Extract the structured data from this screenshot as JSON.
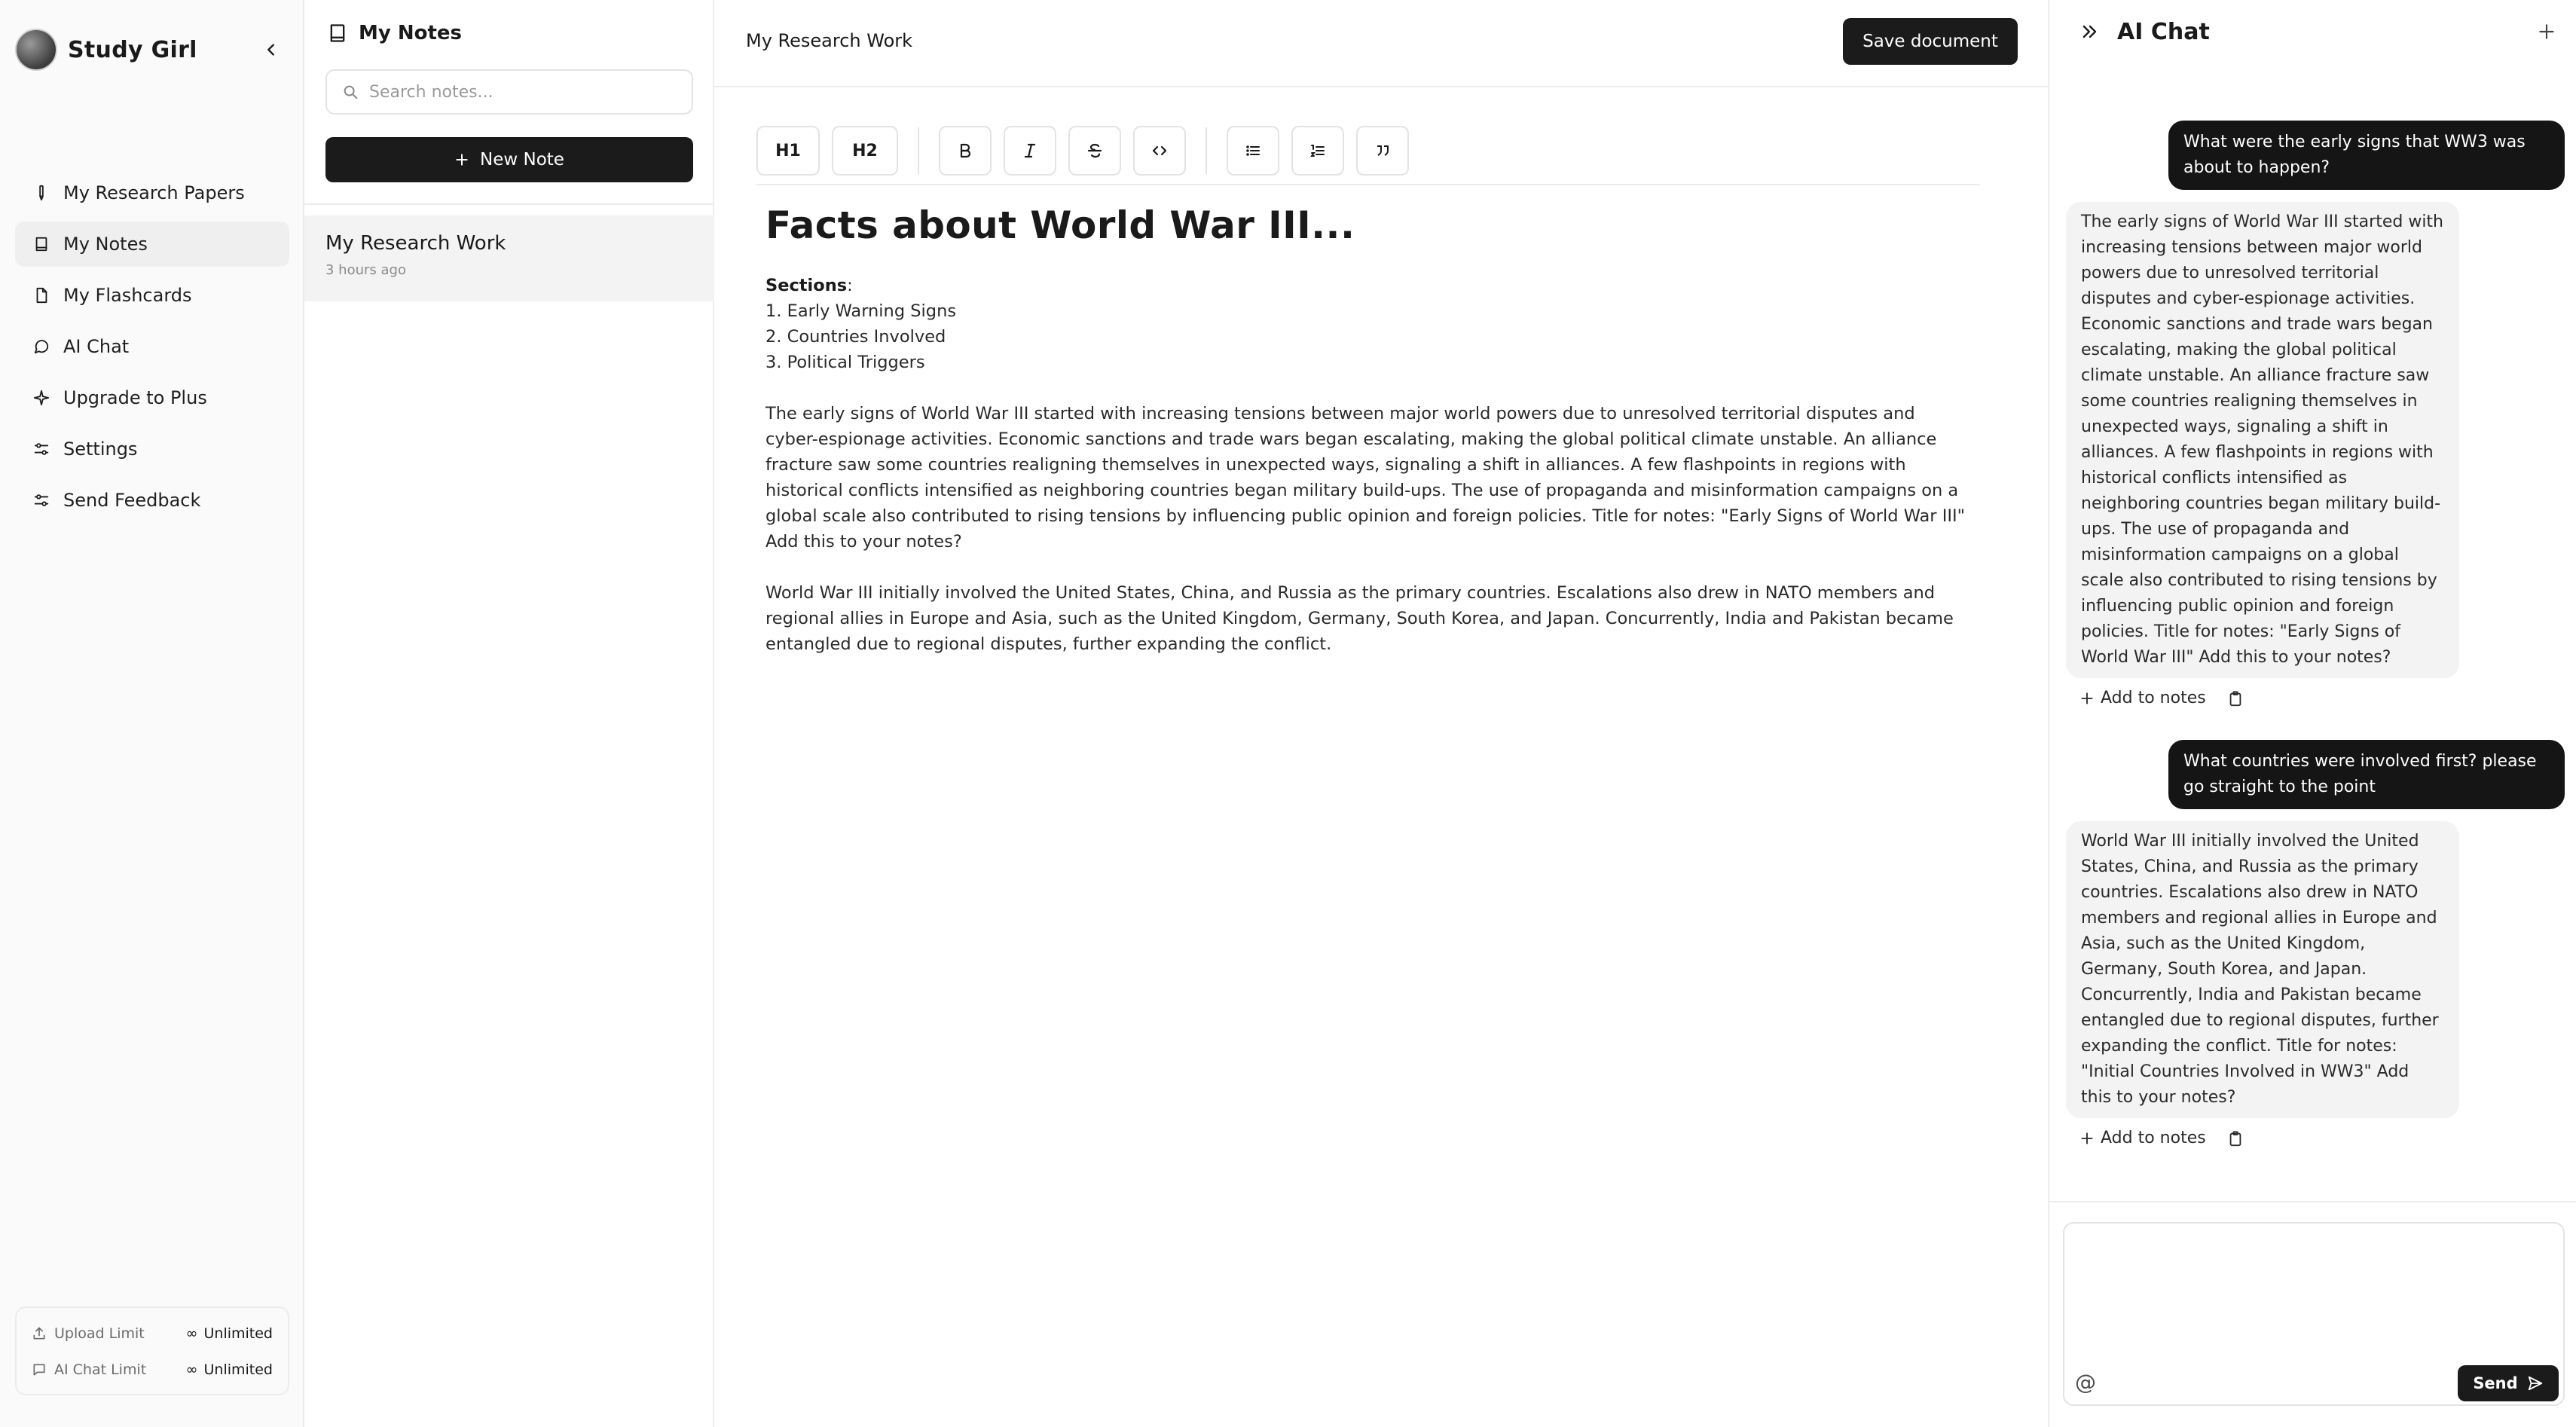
{
  "sidebar": {
    "brand": "Study Girl",
    "items": [
      {
        "label": "My Research Papers",
        "icon": "pen-icon"
      },
      {
        "label": "My Notes",
        "icon": "notebook-icon",
        "active": true
      },
      {
        "label": "My Flashcards",
        "icon": "file-icon"
      },
      {
        "label": "AI Chat",
        "icon": "chat-bubble-icon"
      },
      {
        "label": "Upgrade to Plus",
        "icon": "sparkle-icon"
      },
      {
        "label": "Settings",
        "icon": "sliders-icon"
      },
      {
        "label": "Send Feedback",
        "icon": "sliders-icon"
      }
    ],
    "limits": [
      {
        "label": "Upload Limit",
        "value": "Unlimited"
      },
      {
        "label": "AI Chat Limit",
        "value": "Unlimited"
      }
    ]
  },
  "notes": {
    "title": "My Notes",
    "search_placeholder": "Search notes...",
    "new_note_label": "New Note",
    "items": [
      {
        "title": "My Research Work",
        "time": "3 hours ago"
      }
    ]
  },
  "editor": {
    "doc_name": "My Research Work",
    "save_label": "Save document",
    "toolbar": {
      "h1": "H1",
      "h2": "H2"
    },
    "title": "Facts about World War III...",
    "sections_label": "Sections",
    "sections": [
      "1. Early Warning Signs",
      "2. Countries Involved",
      "3. Political Triggers"
    ],
    "paragraphs": [
      "The early signs of World War III started with increasing tensions between major world powers due to unresolved territorial disputes and cyber-espionage activities. Economic sanctions and trade wars began escalating, making the global political climate unstable. An alliance fracture saw some countries realigning themselves in unexpected ways, signaling a shift in alliances. A few flashpoints in regions with historical conflicts intensified as neighboring countries began military build-ups. The use of propaganda and misinformation campaigns on a global scale also contributed to rising tensions by influencing public opinion and foreign policies. Title for notes: \"Early Signs of World War III\" Add this to your notes?",
      "World War III initially involved the United States, China, and Russia as the primary countries. Escalations also drew in NATO members and regional allies in Europe and Asia, such as the United Kingdom, Germany, South Korea, and Japan. Concurrently, India and Pakistan became entangled due to regional disputes, further expanding the conflict."
    ]
  },
  "chat": {
    "title": "AI Chat",
    "messages": [
      {
        "role": "user",
        "text": "What were the early signs that WW3 was about to happen?"
      },
      {
        "role": "ai",
        "text": "The early signs of World War III started with increasing tensions between major world powers due to unresolved territorial disputes and cyber-espionage activities. Economic sanctions and trade wars began escalating, making the global political climate unstable. An alliance fracture saw some countries realigning themselves in unexpected ways, signaling a shift in alliances. A few flashpoints in regions with historical conflicts intensified as neighboring countries began military build-ups. The use of propaganda and misinformation campaigns on a global scale also contributed to rising tensions by influencing public opinion and foreign policies. Title for notes: \"Early Signs of World War III\" Add this to your notes?"
      },
      {
        "role": "user",
        "text": "What countries were involved first? please go straight to the point"
      },
      {
        "role": "ai",
        "text": "World War III initially involved the United States, China, and Russia as the primary countries. Escalations also drew in NATO members and regional allies in Europe and Asia, such as the United Kingdom, Germany, South Korea, and Japan. Concurrently, India and Pakistan became entangled due to regional disputes, further expanding the conflict. Title for notes: \"Initial Countries Involved in WW3\" Add this to your notes?"
      }
    ],
    "add_to_notes_label": "Add to notes",
    "input_value": "",
    "mention_symbol": "@",
    "send_label": "Send"
  }
}
